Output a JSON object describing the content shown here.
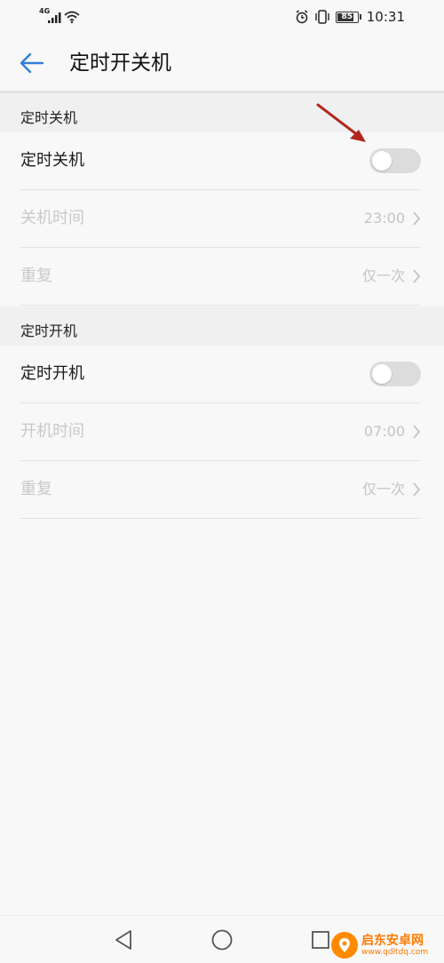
{
  "status_bar": {
    "network": "4G",
    "battery": "85",
    "battery_level": 0.85,
    "time": "10:31",
    "icons": [
      "signal-icon",
      "wifi-icon",
      "alarm-icon",
      "vibrate-icon",
      "battery-icon"
    ]
  },
  "header": {
    "title": "定时开关机"
  },
  "sections": [
    {
      "header": "定时关机",
      "toggle_label": "定时关机",
      "toggle_on": false,
      "time_label": "关机时间",
      "time_value": "23:00",
      "repeat_label": "重复",
      "repeat_value": "仅一次"
    },
    {
      "header": "定时开机",
      "toggle_label": "定时开机",
      "toggle_on": false,
      "time_label": "开机时间",
      "time_value": "07:00",
      "repeat_label": "重复",
      "repeat_value": "仅一次"
    }
  ],
  "watermark": {
    "name": "启东安卓网",
    "url": "www.qdltdq.com"
  },
  "colors": {
    "accent": "#2f7fd3",
    "arrow": "#b3261e",
    "toggle_off": "#dcdcdc",
    "disabled_text": "#c9c9c9"
  }
}
